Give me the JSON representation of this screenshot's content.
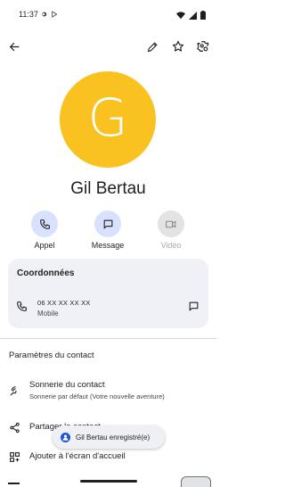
{
  "status_bar": {
    "time": "11:37"
  },
  "top_bar": {
    "back_icon": "arrow-back-icon",
    "edit_icon": "pencil-icon",
    "favorite_icon": "star-outline-icon",
    "settings_icon": "contact-settings-icon"
  },
  "contact": {
    "initial": "G",
    "name": "Gil Bertau",
    "avatar_color": "#f9c221"
  },
  "actions": [
    {
      "label": "Appel",
      "icon": "phone-icon",
      "enabled": true
    },
    {
      "label": "Message",
      "icon": "message-icon",
      "enabled": true
    },
    {
      "label": "Vidéo",
      "icon": "video-icon",
      "enabled": false
    }
  ],
  "coordinates": {
    "title": "Coordonnées",
    "phone": "06 XX XX XX XX",
    "phone_type": "Mobile"
  },
  "settings": {
    "title": "Paramètres du contact",
    "ringtone_title": "Sonnerie du contact",
    "ringtone_sub": "Sonnerie par défaut (Votre nouvelle aventure)",
    "share_title": "Partager le contact",
    "homescreen_title": "Ajouter à l'écran d'accueil"
  },
  "toast": {
    "text": "Gil Bertau enregistré(e)"
  },
  "colors": {
    "accent_circle": "#d8e2ff",
    "card_bg": "#f0f1f7",
    "icon_color": "#1f1f1f"
  }
}
